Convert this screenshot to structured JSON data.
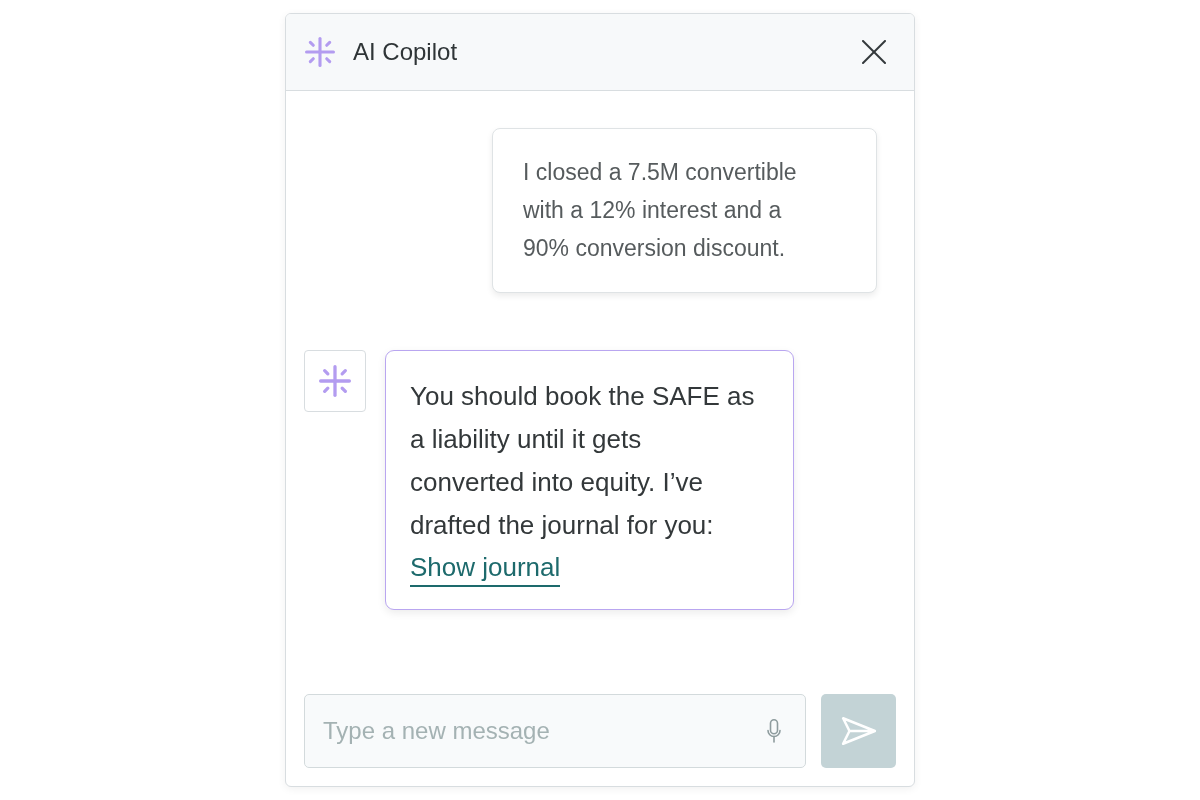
{
  "window": {
    "title": "AI Copilot"
  },
  "messages": [
    {
      "kind": "user",
      "text": "I closed a 7.5M convertible with a 12% interest and a 90% conversion discount."
    },
    {
      "kind": "assistant",
      "text": "You should book the SAFE as a liability until it gets converted into equity. I’ve drafted the journal for you:",
      "link": "Show journal"
    }
  ],
  "composer": {
    "placeholder": "Type a new message"
  },
  "send_button": {
    "disabled": true
  }
}
